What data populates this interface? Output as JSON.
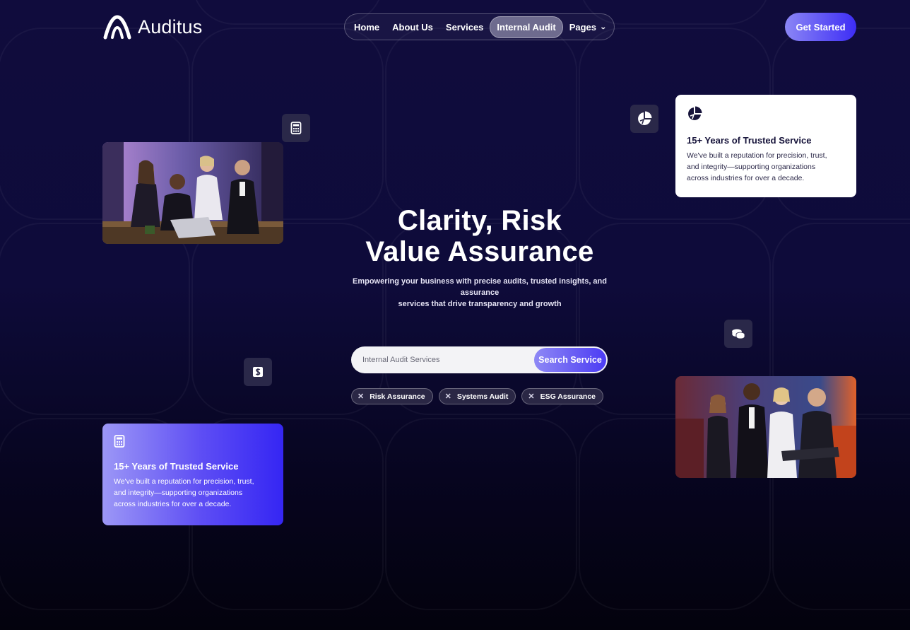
{
  "header": {
    "logo_text": "Auditus",
    "nav": [
      {
        "label": "Home"
      },
      {
        "label": "About Us"
      },
      {
        "label": "Services"
      },
      {
        "label": "Internal Audit",
        "active": true
      },
      {
        "label": "Pages",
        "has_dropdown": true
      }
    ],
    "cta_label": "Get Started"
  },
  "hero": {
    "title_line1": "Clarity, Risk",
    "title_line2": "Value Assurance",
    "subtitle_line1": "Empowering your business with precise audits, trusted insights, and assurance",
    "subtitle_line2": "services that drive transparency and growth"
  },
  "search": {
    "placeholder": "Internal Audit Services",
    "button_label": "Search Service"
  },
  "tags": [
    {
      "label": "Risk Assurance"
    },
    {
      "label": "Systems Audit"
    },
    {
      "label": "ESG Assurance"
    }
  ],
  "cards": {
    "white": {
      "icon": "pie-chart-icon",
      "title": "15+ Years of Trusted Service",
      "body_line1": "We've built a reputation for precision, trust,",
      "body_line2": "and integrity—supporting organizations",
      "body_line3": "across industries for over a decade."
    },
    "blue": {
      "icon": "calculator-icon",
      "title": "15+ Years of Trusted Service",
      "body_line1": "We've built a reputation for precision, trust,",
      "body_line2": "and integrity—supporting organizations",
      "body_line3": "across industries for over a decade."
    }
  },
  "floating_icons": [
    "calculator-icon",
    "pie-chart-icon",
    "coins-icon",
    "dollar-icon"
  ],
  "colors": {
    "background_top": "#100c3d",
    "background_bottom": "#03020d",
    "accent_start": "#8b86f5",
    "accent_end": "#3d2df5"
  }
}
